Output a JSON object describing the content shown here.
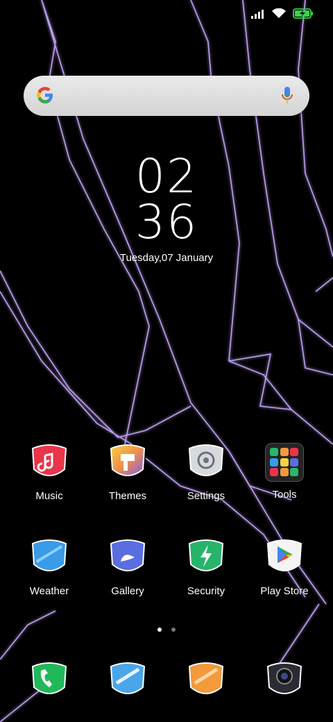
{
  "status_bar": {
    "signal": "signal-icon",
    "wifi": "wifi-icon",
    "battery": "battery-charging-icon"
  },
  "search": {
    "left_icon": "google-g-icon",
    "right_icon": "microphone-icon"
  },
  "clock": {
    "hours": "02",
    "minutes": "36",
    "date": "Tuesday,07 January"
  },
  "apps_row1": [
    {
      "label": "Music",
      "icon": "music-icon",
      "color": "#e8354a"
    },
    {
      "label": "Themes",
      "icon": "themes-icon",
      "color": "#f2b63c"
    },
    {
      "label": "Settings",
      "icon": "settings-icon",
      "color": "#c9ccd1"
    },
    {
      "label": "Tools",
      "icon": "tools-folder-icon",
      "color": "#333333"
    }
  ],
  "apps_row2": [
    {
      "label": "Weather",
      "icon": "weather-icon",
      "color": "#3a9be8"
    },
    {
      "label": "Gallery",
      "icon": "gallery-icon",
      "color": "#5a6ee0"
    },
    {
      "label": "Security",
      "icon": "security-icon",
      "color": "#27b46a"
    },
    {
      "label": "Play Store",
      "icon": "play-store-icon",
      "color": "#ffffff"
    }
  ],
  "dock": [
    {
      "icon": "phone-icon",
      "color": "#21b85a"
    },
    {
      "icon": "messages-icon",
      "color": "#4aa6e8"
    },
    {
      "icon": "browser-icon",
      "color": "#f39a3c"
    },
    {
      "icon": "camera-icon",
      "color": "#2b2b35"
    }
  ],
  "page_indicator": {
    "pages": 2,
    "current": 1
  }
}
